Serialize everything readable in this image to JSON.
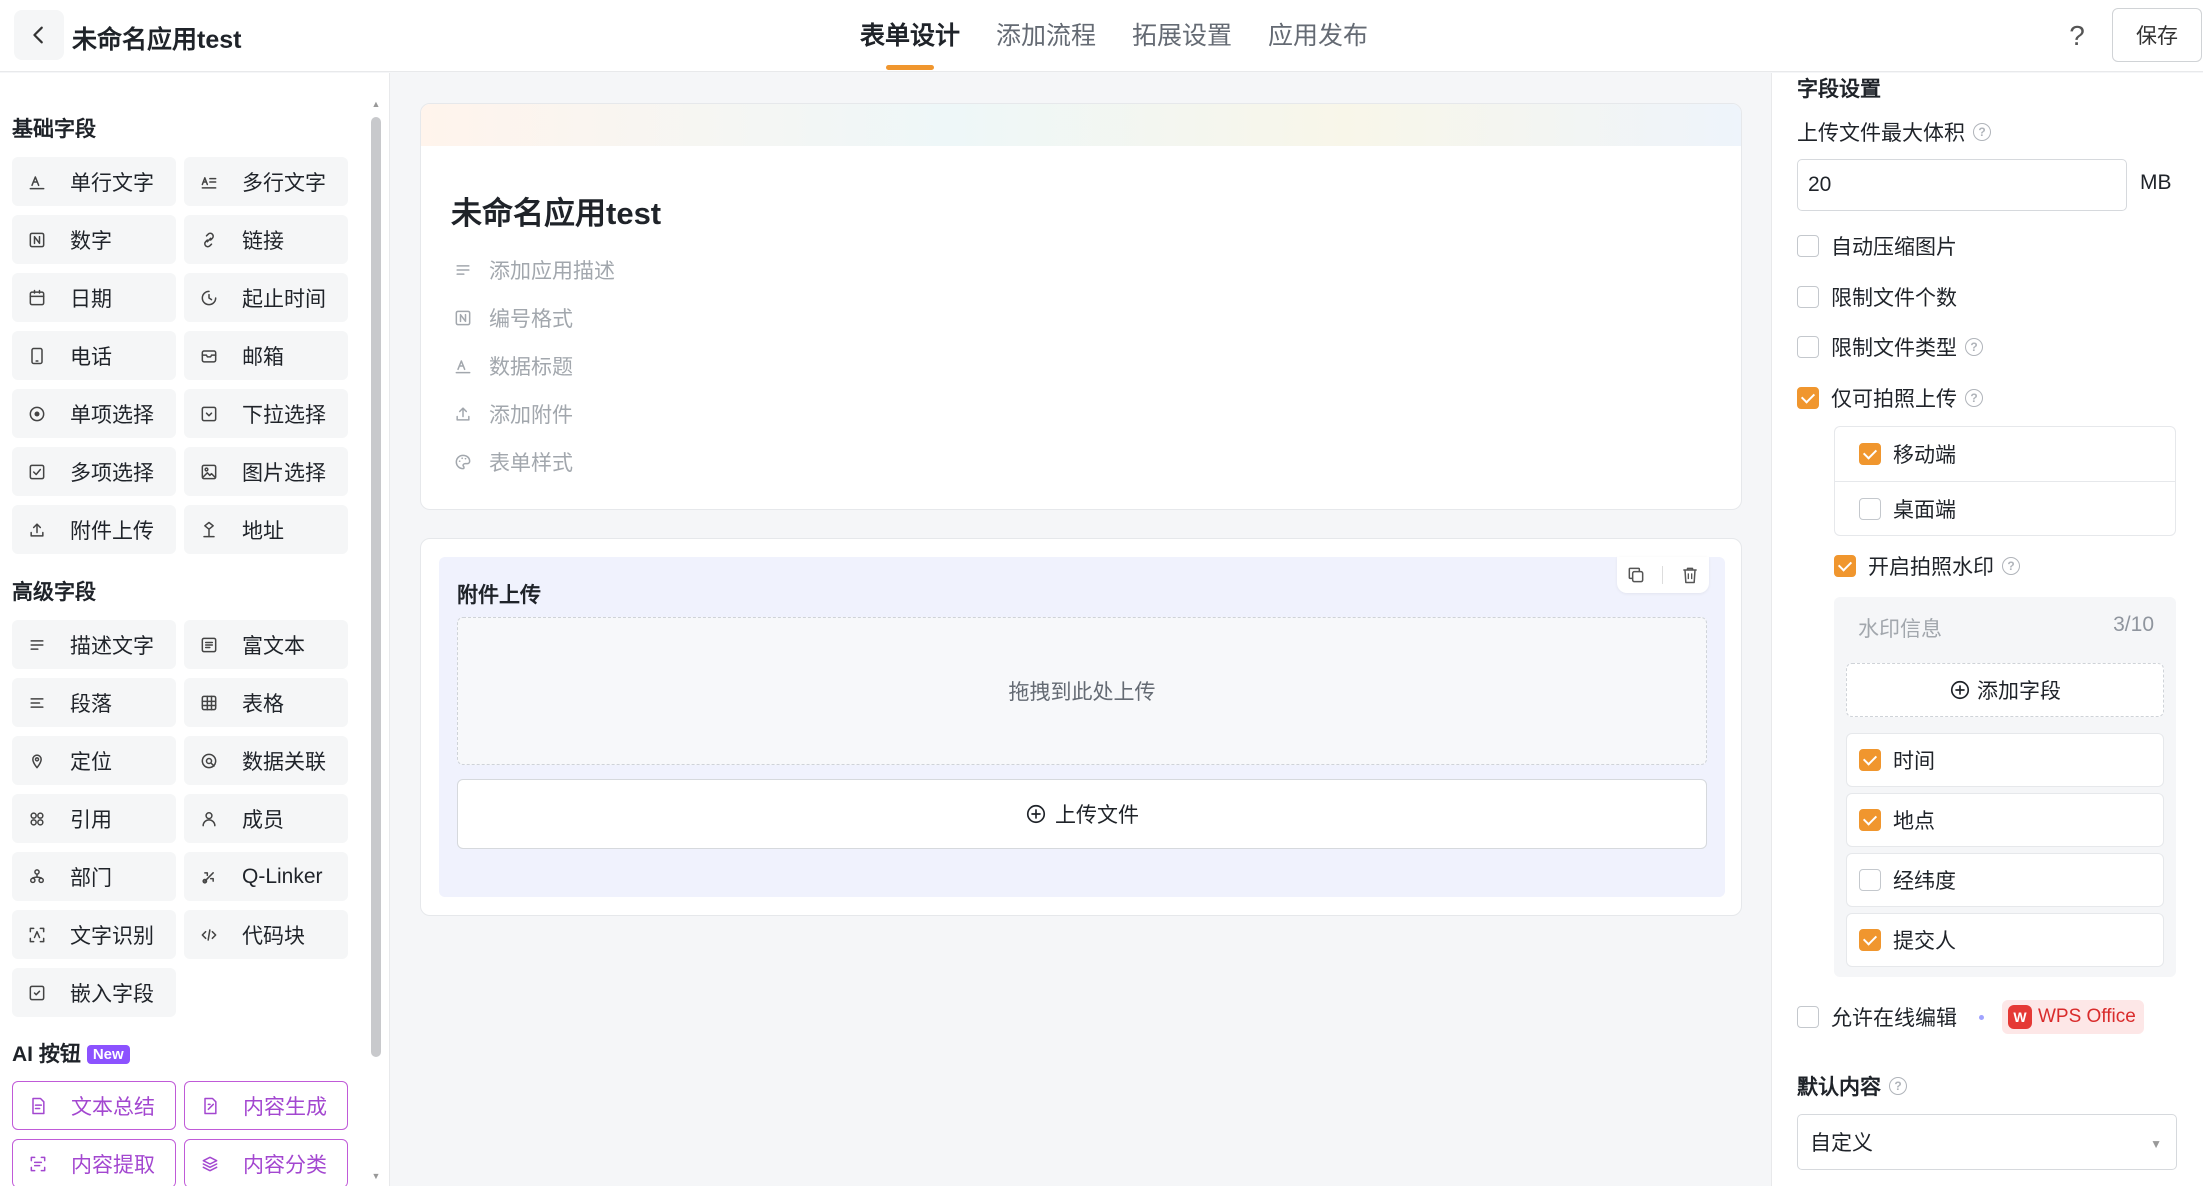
{
  "header": {
    "title": "未命名应用test",
    "tabs": [
      {
        "label": "表单设计",
        "active": true
      },
      {
        "label": "添加流程",
        "active": false
      },
      {
        "label": "拓展设置",
        "active": false
      },
      {
        "label": "应用发布",
        "active": false
      }
    ],
    "help": "?",
    "save_label": "保存"
  },
  "left": {
    "basic_title": "基础字段",
    "basic_fields": [
      {
        "label": "单行文字",
        "icon": "single-line-text-icon"
      },
      {
        "label": "多行文字",
        "icon": "multi-line-text-icon"
      },
      {
        "label": "数字",
        "icon": "number-icon"
      },
      {
        "label": "链接",
        "icon": "link-icon"
      },
      {
        "label": "日期",
        "icon": "calendar-icon"
      },
      {
        "label": "起止时间",
        "icon": "time-range-icon"
      },
      {
        "label": "电话",
        "icon": "phone-icon"
      },
      {
        "label": "邮箱",
        "icon": "mail-icon"
      },
      {
        "label": "单项选择",
        "icon": "radio-icon"
      },
      {
        "label": "下拉选择",
        "icon": "dropdown-icon"
      },
      {
        "label": "多项选择",
        "icon": "checkbox-icon"
      },
      {
        "label": "图片选择",
        "icon": "image-icon"
      },
      {
        "label": "附件上传",
        "icon": "upload-icon"
      },
      {
        "label": "地址",
        "icon": "address-icon"
      }
    ],
    "advanced_title": "高级字段",
    "advanced_fields": [
      {
        "label": "描述文字",
        "icon": "description-icon"
      },
      {
        "label": "富文本",
        "icon": "rich-text-icon"
      },
      {
        "label": "段落",
        "icon": "paragraph-icon"
      },
      {
        "label": "表格",
        "icon": "table-icon"
      },
      {
        "label": "定位",
        "icon": "location-icon"
      },
      {
        "label": "数据关联",
        "icon": "data-link-icon"
      },
      {
        "label": "引用",
        "icon": "reference-icon"
      },
      {
        "label": "成员",
        "icon": "member-icon"
      },
      {
        "label": "部门",
        "icon": "department-icon"
      },
      {
        "label": "Q-Linker",
        "icon": "q-linker-icon"
      },
      {
        "label": "文字识别",
        "icon": "ocr-icon"
      },
      {
        "label": "代码块",
        "icon": "code-icon"
      },
      {
        "label": "嵌入字段",
        "icon": "embed-icon"
      }
    ],
    "ai_title": "AI 按钮",
    "ai_badge": "New",
    "ai_buttons": [
      {
        "label": "文本总结",
        "icon": "summary-icon"
      },
      {
        "label": "内容生成",
        "icon": "generate-icon"
      },
      {
        "label": "内容提取",
        "icon": "extract-icon"
      },
      {
        "label": "内容分类",
        "icon": "classify-icon"
      }
    ]
  },
  "form": {
    "name": "未命名应用test",
    "meta": [
      {
        "label": "添加应用描述",
        "icon": "description-icon"
      },
      {
        "label": "编号格式",
        "icon": "number-format-icon"
      },
      {
        "label": "数据标题",
        "icon": "data-title-icon"
      },
      {
        "label": "添加附件",
        "icon": "upload-icon"
      },
      {
        "label": "表单样式",
        "icon": "palette-icon"
      }
    ],
    "upload_field": {
      "label": "附件上传",
      "drop_text": "拖拽到此处上传",
      "button_label": "上传文件"
    }
  },
  "settings": {
    "title": "字段设置",
    "max_size_label": "上传文件最大体积",
    "max_size_value": "20",
    "unit": "MB",
    "options": [
      {
        "label": "自动压缩图片",
        "checked": false
      },
      {
        "label": "限制文件个数",
        "checked": false
      },
      {
        "label": "限制文件类型",
        "checked": false,
        "help": true
      },
      {
        "label": "仅可拍照上传",
        "checked": true,
        "help": true
      }
    ],
    "devices": [
      {
        "label": "移动端",
        "checked": true
      },
      {
        "label": "桌面端",
        "checked": false
      }
    ],
    "watermark": {
      "label": "开启拍照水印",
      "checked": true,
      "info_placeholder": "水印信息",
      "count": "3/10",
      "add_label": "添加字段",
      "items": [
        {
          "label": "时间",
          "checked": true
        },
        {
          "label": "地点",
          "checked": true
        },
        {
          "label": "经纬度",
          "checked": false
        },
        {
          "label": "提交人",
          "checked": true
        }
      ]
    },
    "online_edit": {
      "label": "允许在线编辑",
      "checked": false,
      "badge": "WPS Office"
    },
    "default_title": "默认内容",
    "default_value": "自定义",
    "accent": "#f0962e"
  }
}
